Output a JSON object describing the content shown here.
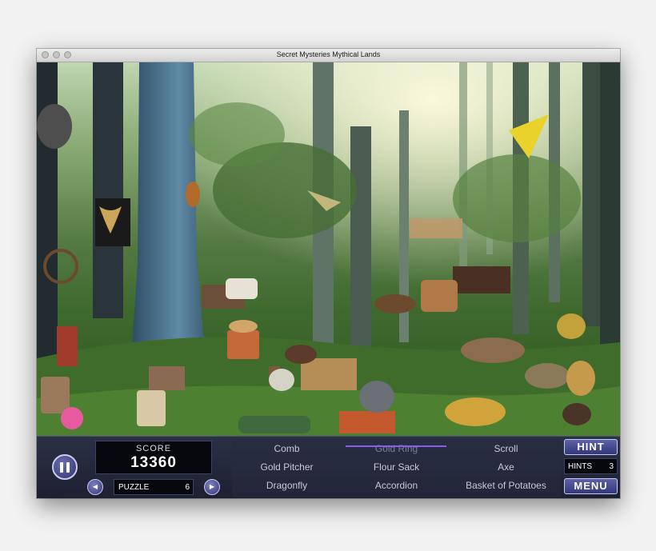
{
  "window": {
    "title": "Secret Mysteries Mythical Lands"
  },
  "hud": {
    "score_label": "SCORE",
    "score_value": "13360",
    "puzzle_label": "PUZZLE",
    "puzzle_number": "6",
    "hint_label": "HINT",
    "hints_label": "HINTS",
    "hints_count": "3",
    "menu_label": "MENU"
  },
  "items": [
    {
      "label": "Comb",
      "found": false
    },
    {
      "label": "Gold Ring",
      "found": true
    },
    {
      "label": "Scroll",
      "found": false
    },
    {
      "label": "Gold Pitcher",
      "found": false
    },
    {
      "label": "Flour Sack",
      "found": false
    },
    {
      "label": "Axe",
      "found": false
    },
    {
      "label": "Dragonfly",
      "found": false
    },
    {
      "label": "Accordion",
      "found": false
    },
    {
      "label": "Basket of Potatoes",
      "found": false
    }
  ],
  "colors": {
    "accent": "#8b5cf0",
    "hud_bg": "#1c2031",
    "button": "#4a4f96"
  }
}
